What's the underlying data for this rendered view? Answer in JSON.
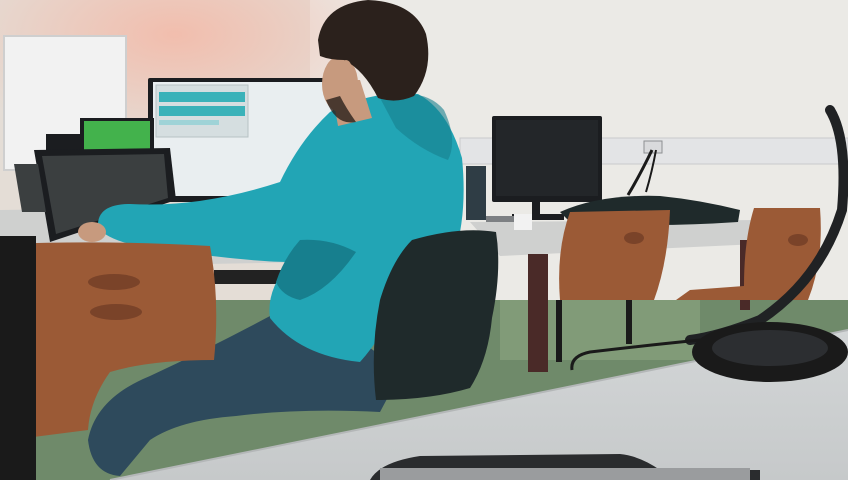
{
  "scene": {
    "colors": {
      "wall_left": "#e4ddd6",
      "wall_right": "#ebeae6",
      "wall_glow": "#f2c7b8",
      "trunking": "#e3e4e6",
      "whiteboard": "#f2f2f2",
      "floor": "#6f8a6a",
      "desk_top": "#cfd0cf",
      "desk_near": "#d5d7d8",
      "desk_edge": "#b9bbbc",
      "desk_leg": "#4a2a28",
      "chair_wood": "#9b5a36",
      "chair_wood_dark": "#7a4329",
      "hoodie": "#22a5b5",
      "hoodie_shadow": "#177f8e",
      "jeans": "#2e4a5c",
      "hair": "#2b211c",
      "skin": "#c79a7e",
      "jacket": "#1f2a2b",
      "monitor_bezel": "#1b1d20",
      "monitor_screen_off": "#232629",
      "screen_white": "#e9eef0",
      "screen_bar": "#3ab2b9",
      "screen_green": "#43b24c",
      "laptop_screen": "#3b3f40",
      "cable": "#1a1a1a"
    }
  }
}
